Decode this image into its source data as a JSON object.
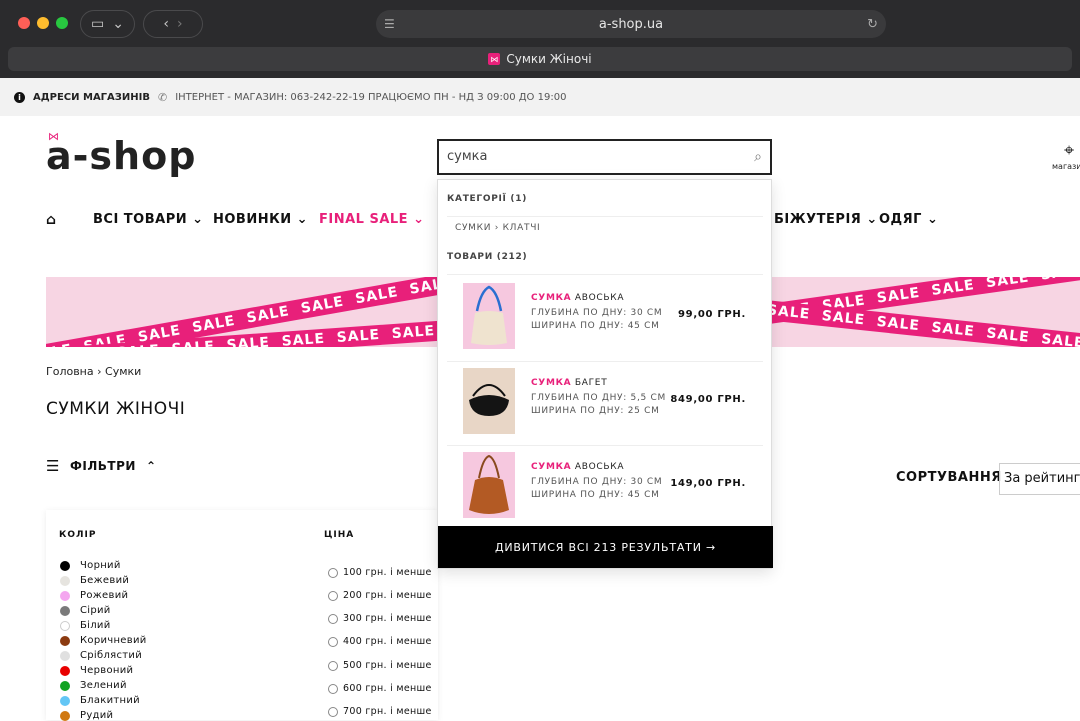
{
  "browser": {
    "url": "a-shop.ua",
    "tab_title": "Сумки Жіночі"
  },
  "infobar": {
    "stores": "АДРЕСИ МАГАЗИНІВ",
    "phone_text": "ІНТЕРНЕТ - МАГАЗИН: 063-242-22-19 ПРАЦЮЄМО ПН - НД З 09:00 ДО 19:00"
  },
  "header": {
    "logo": "a-shop",
    "stores_label": "магазин"
  },
  "nav": {
    "items": [
      "ВСІ ТОВАРИ",
      "НОВИНКИ",
      "FINAL SALE",
      "БІЖУТЕРІЯ",
      "ОДЯГ"
    ],
    "sale_color": "#e8207a"
  },
  "banner": {
    "word": "SALE"
  },
  "breadcrumb": {
    "home": "Головна",
    "current": "Сумки"
  },
  "page": {
    "title": "СУМКИ ЖІНОЧІ",
    "filters_label": "ФІЛЬТРИ",
    "sort_label": "СОРТУВАННЯ",
    "sort_value": "За рейтингом"
  },
  "filters": {
    "color_header": "КОЛІР",
    "price_header": "ЦІНА",
    "colors": [
      {
        "name": "Чорний",
        "hex": "#000000"
      },
      {
        "name": "Бежевий",
        "hex": "#e6e4df"
      },
      {
        "name": "Рожевий",
        "hex": "#f4a6ef"
      },
      {
        "name": "Сірий",
        "hex": "#7a7a7a"
      },
      {
        "name": "Білий",
        "hex": "#ffffff"
      },
      {
        "name": "Коричневий",
        "hex": "#8b3a10"
      },
      {
        "name": "Сріблястий",
        "hex": "#e0e0e0"
      },
      {
        "name": "Червоний",
        "hex": "#e80000"
      },
      {
        "name": "Зелений",
        "hex": "#11a322"
      },
      {
        "name": "Блакитний",
        "hex": "#63c6f5"
      },
      {
        "name": "Рудий",
        "hex": "#d07810"
      }
    ],
    "prices": [
      "100 грн. і менше",
      "200 грн. і менше",
      "300 грн. і менше",
      "400 грн. і менше",
      "500 грн. і менше",
      "600 грн. і менше",
      "700 грн. і менше"
    ]
  },
  "search": {
    "value": "сумка",
    "categories_header": "КАТЕГОРІЇ (1)",
    "category_path": "СУМКИ › КЛАТЧІ",
    "products_header": "ТОВАРИ (212)",
    "products": [
      {
        "hl": "СУМКА",
        "name": " АВОСЬКА",
        "depth": "ГЛУБИНА ПО ДНУ: 30 СМ",
        "width": "ШИРИНА ПО ДНУ: 45 СМ",
        "price": "99,00 ГРН."
      },
      {
        "hl": "СУМКА",
        "name": " БАГЕТ",
        "depth": "ГЛУБИНА ПО ДНУ: 5,5 СМ",
        "width": "ШИРИНА ПО ДНУ: 25 СМ",
        "price": "849,00 ГРН."
      },
      {
        "hl": "СУМКА",
        "name": " АВОСЬКА",
        "depth": "ГЛУБИНА ПО ДНУ: 30 СМ",
        "width": "ШИРИНА ПО ДНУ: 45 СМ",
        "price": "149,00 ГРН."
      }
    ],
    "view_all": "ДИВИТИСЯ ВСІ 213 РЕЗУЛЬТАТИ →"
  }
}
